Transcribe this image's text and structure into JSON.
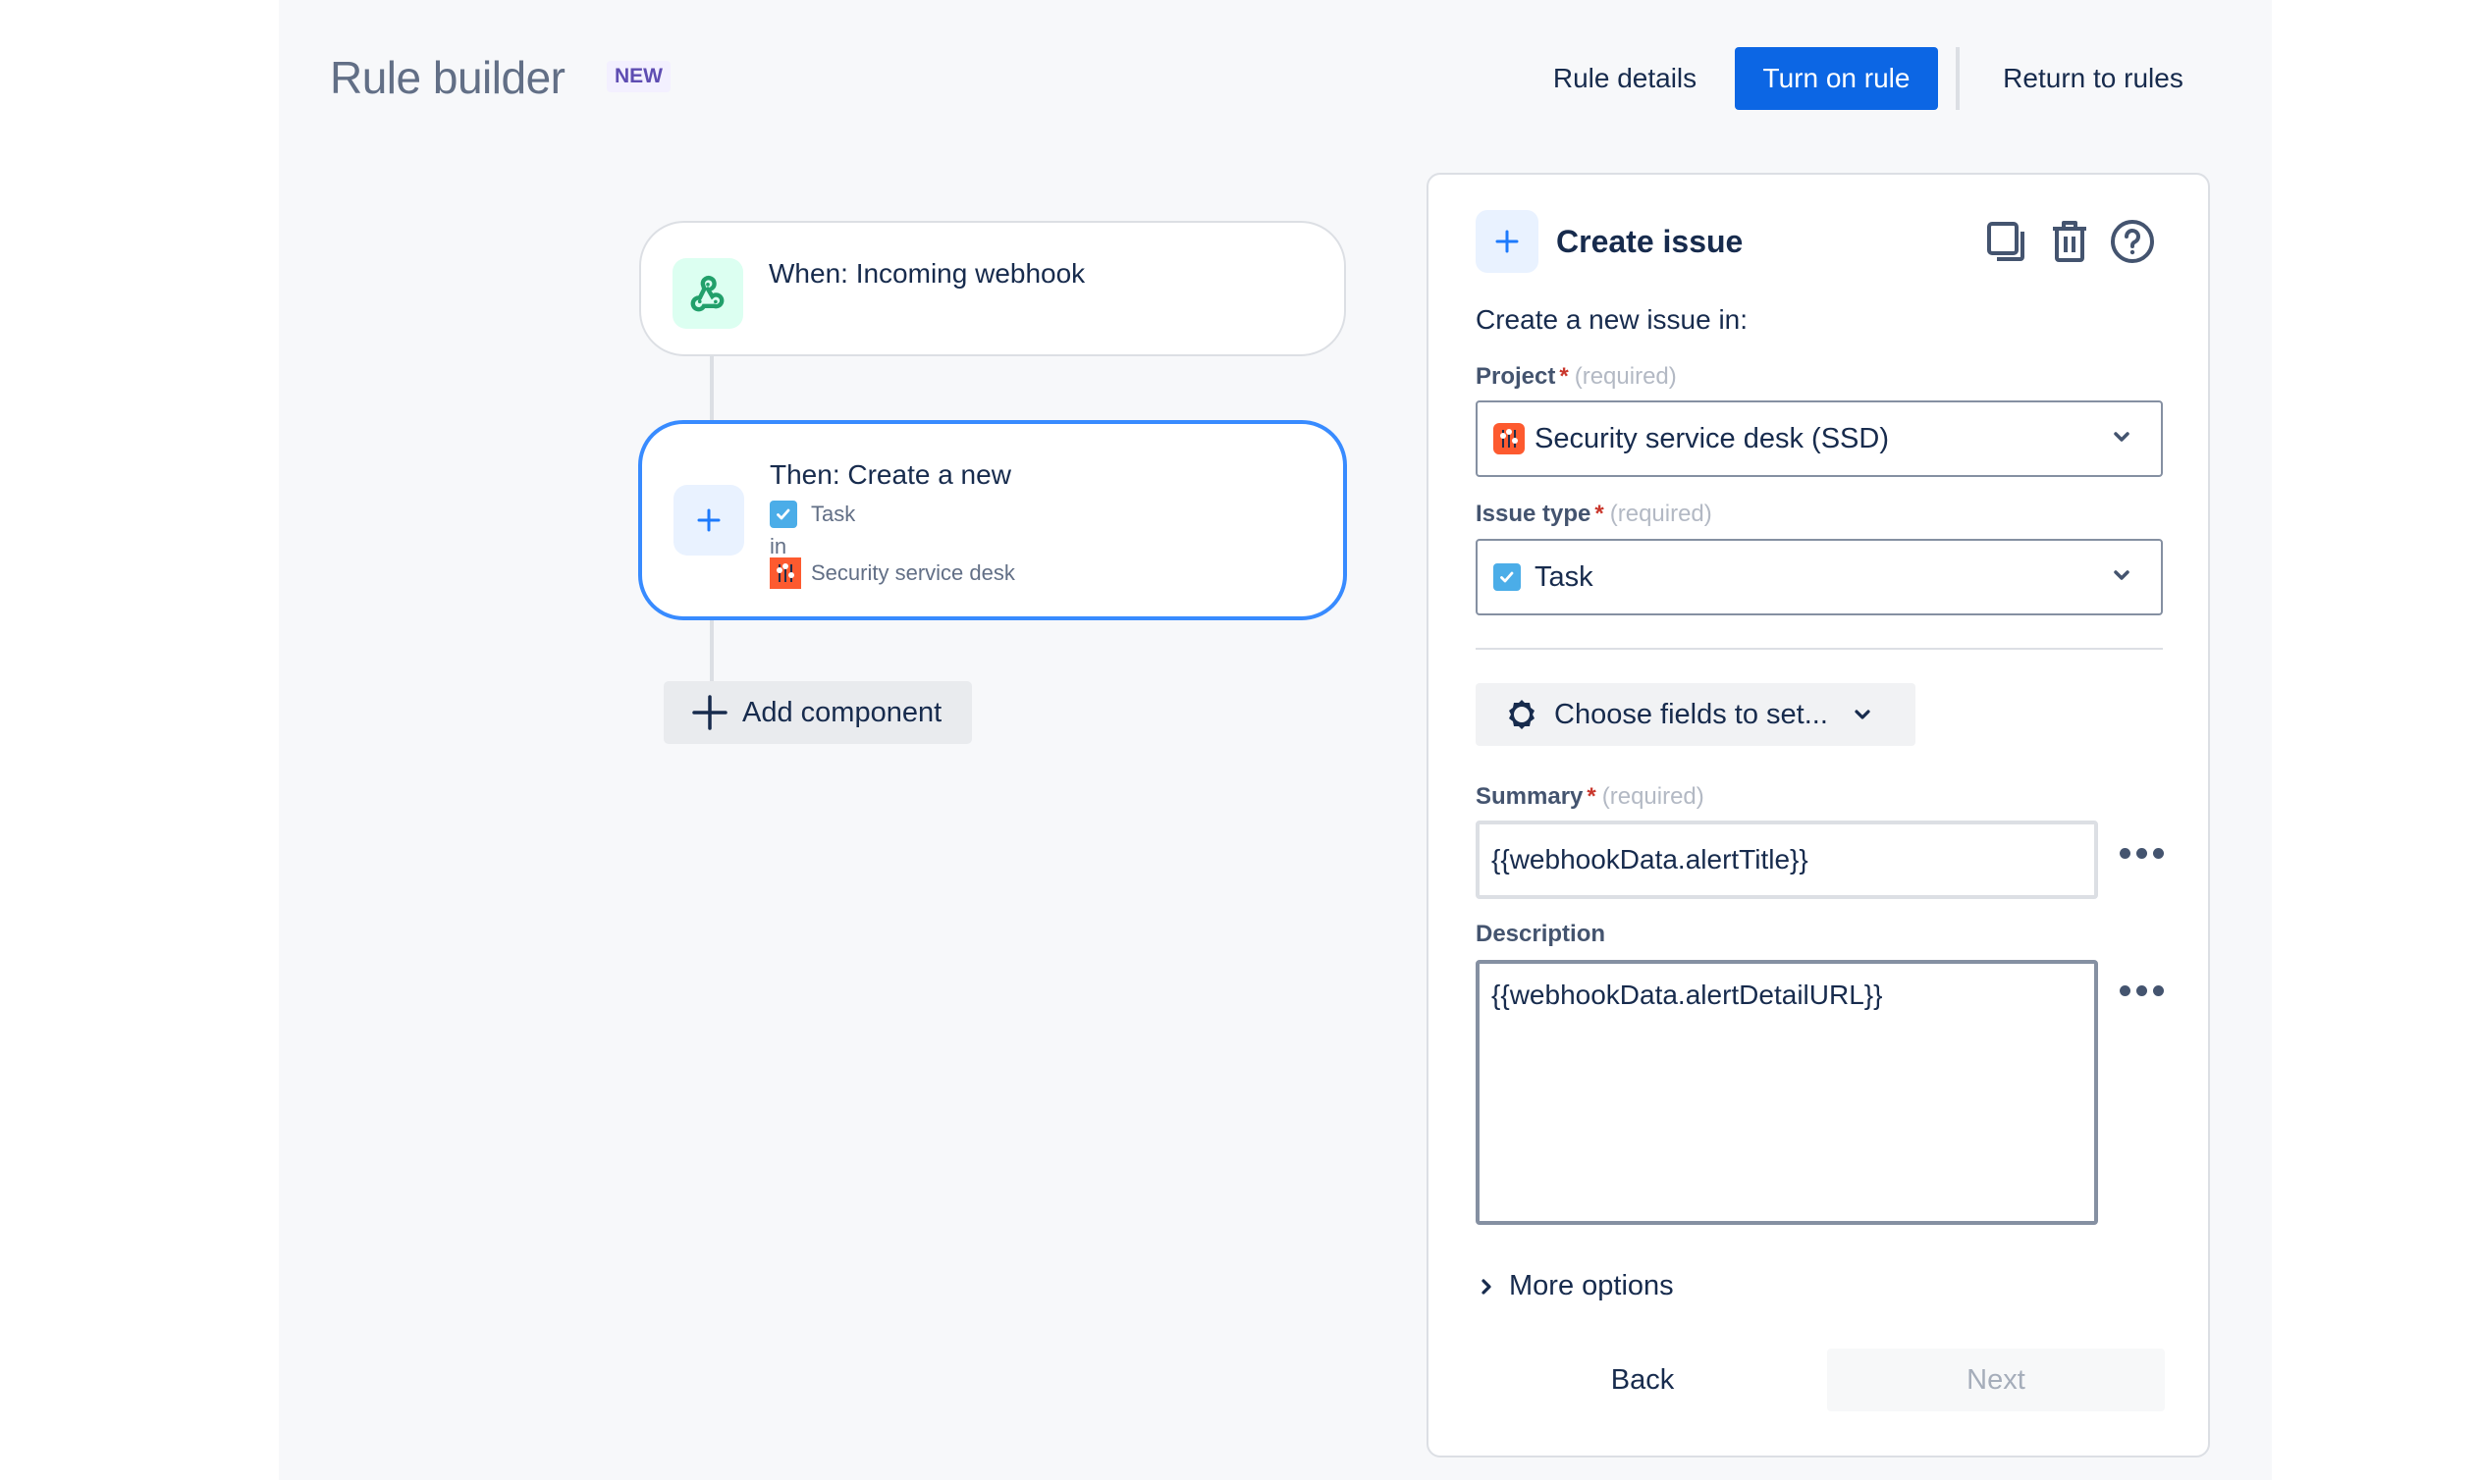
{
  "header": {
    "title": "Rule builder",
    "badge": "NEW",
    "rule_details": "Rule details",
    "turn_on_rule": "Turn on rule",
    "return_to_rules": "Return to rules"
  },
  "flow": {
    "trigger": {
      "icon": "webhook-icon",
      "title": "When: Incoming webhook"
    },
    "action": {
      "icon": "plus-icon",
      "title": "Then: Create a new",
      "issue_type": "Task",
      "in_label": "in",
      "project": "Security service desk"
    },
    "add_component": "Add component"
  },
  "panel": {
    "title": "Create issue",
    "actions": [
      "copy-icon",
      "trash-icon",
      "help-icon"
    ],
    "intro": "Create a new issue in:",
    "project": {
      "label": "Project",
      "required_mark": "*",
      "required_hint": "(required)",
      "value": "Security service desk (SSD)"
    },
    "issue_type": {
      "label": "Issue type",
      "required_mark": "*",
      "required_hint": "(required)",
      "value": "Task"
    },
    "choose_fields": "Choose fields to set...",
    "summary": {
      "label": "Summary",
      "required_mark": "*",
      "required_hint": "(required)",
      "value": "{{webhookData.alertTitle}}"
    },
    "description": {
      "label": "Description",
      "value": "{{webhookData.alertDetailURL}}"
    },
    "more_options": "More options",
    "back": "Back",
    "next": "Next"
  },
  "colors": {
    "primary": "#0c66e4",
    "selected_border": "#388bff",
    "webhook_green": "#22a06b",
    "task_blue": "#4bade8",
    "project_orange": "#fd5a2f",
    "badge_purple": "#5e4db2",
    "required_red": "#c9372c"
  }
}
